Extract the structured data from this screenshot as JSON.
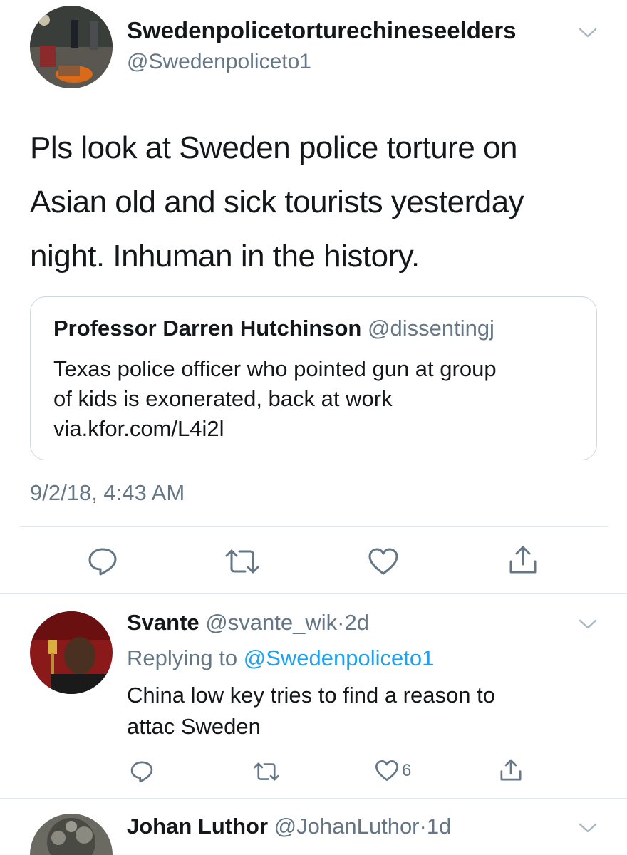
{
  "tweet": {
    "author_name": "Swedenpolicetorturechineseelders",
    "author_handle": "@Swedenpoliceto1",
    "text_lines": [
      "Pls look at Sweden police torture on",
      "Asian old and sick tourists yesterday",
      "night. Inhuman in the history."
    ],
    "quote": {
      "author_name": "Professor Darren Hutchinson",
      "author_handle": "@dissentingj",
      "text_lines": [
        "Texas police officer who pointed gun at group",
        "of kids is exonerated, back at work",
        "via.kfor.com/L4i2l"
      ]
    },
    "timestamp": "9/2/18, 4:43 AM",
    "actions": [
      "reply-icon",
      "retweet-icon",
      "like-icon",
      "share-icon"
    ]
  },
  "replies": [
    {
      "author_name": "Svante",
      "author_handle": "@svante_wik",
      "separator": "·",
      "age": "2d",
      "replying_prefix": "Replying to",
      "replying_to": "@Swedenpoliceto1",
      "text_lines": [
        "China low key tries to find a reason to",
        "attac Sweden"
      ],
      "like_count": "6"
    },
    {
      "author_name": "Johan Luthor",
      "author_handle": "@JohanLuthor",
      "separator": "·",
      "age": "1d"
    }
  ],
  "colors": {
    "text": "#14171a",
    "secondary": "#657786",
    "link": "#1da1f2",
    "divider": "#e1e8ed",
    "border": "#ccd6dd"
  }
}
